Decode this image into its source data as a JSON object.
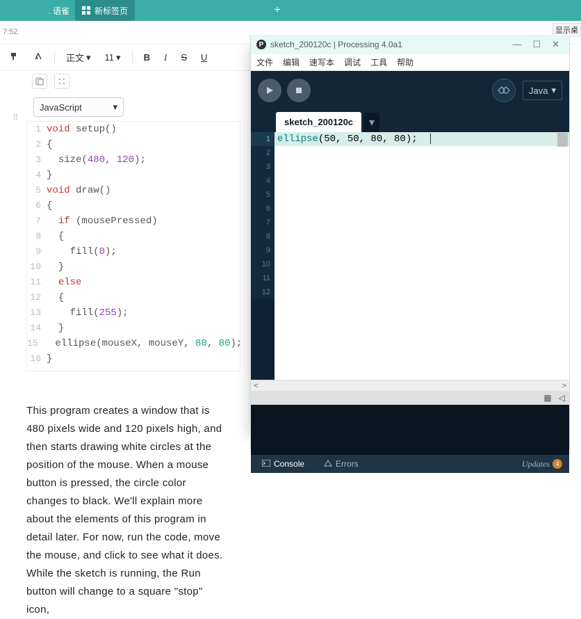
{
  "browser": {
    "tab_left_suffix": ". 语雀",
    "new_tab": "新标签页",
    "plus": "+",
    "time": "7:52",
    "top_right": "显示桌"
  },
  "toolbar": {
    "style_label": "正文",
    "font_size": "11",
    "bold": "B",
    "italic": "I",
    "strike": "S",
    "underline": "U"
  },
  "lang": {
    "value": "JavaScript"
  },
  "code": {
    "lines": [
      {
        "ln": "1",
        "tokens": [
          {
            "t": "void",
            "c": "k-red"
          },
          {
            "t": " setup()",
            "c": "k-text"
          }
        ]
      },
      {
        "ln": "2",
        "tokens": [
          {
            "t": "{",
            "c": "k-text"
          }
        ]
      },
      {
        "ln": "3",
        "tokens": [
          {
            "t": "  size(",
            "c": "k-text"
          },
          {
            "t": "480",
            "c": "k-violet"
          },
          {
            "t": ", ",
            "c": "k-text"
          },
          {
            "t": "120",
            "c": "k-violet"
          },
          {
            "t": ");",
            "c": "k-text"
          }
        ]
      },
      {
        "ln": "4",
        "tokens": [
          {
            "t": "}",
            "c": "k-text"
          }
        ]
      },
      {
        "ln": "5",
        "tokens": [
          {
            "t": "void",
            "c": "k-red"
          },
          {
            "t": " draw()",
            "c": "k-text"
          }
        ]
      },
      {
        "ln": "6",
        "tokens": [
          {
            "t": "{",
            "c": "k-text"
          }
        ]
      },
      {
        "ln": "7",
        "tokens": [
          {
            "t": "  ",
            "c": "k-text"
          },
          {
            "t": "if",
            "c": "k-red"
          },
          {
            "t": " (mousePressed)",
            "c": "k-text"
          }
        ]
      },
      {
        "ln": "8",
        "tokens": [
          {
            "t": "  {",
            "c": "k-text"
          }
        ]
      },
      {
        "ln": "9",
        "tokens": [
          {
            "t": "    fill(",
            "c": "k-text"
          },
          {
            "t": "0",
            "c": "k-violet"
          },
          {
            "t": ");",
            "c": "k-text"
          }
        ]
      },
      {
        "ln": "10",
        "tokens": [
          {
            "t": "  }",
            "c": "k-text"
          }
        ]
      },
      {
        "ln": "11",
        "tokens": [
          {
            "t": "  ",
            "c": "k-text"
          },
          {
            "t": "else",
            "c": "k-red"
          }
        ]
      },
      {
        "ln": "12",
        "tokens": [
          {
            "t": "  {",
            "c": "k-text"
          }
        ]
      },
      {
        "ln": "13",
        "tokens": [
          {
            "t": "    fill(",
            "c": "k-text"
          },
          {
            "t": "255",
            "c": "k-violet"
          },
          {
            "t": ");",
            "c": "k-text"
          }
        ]
      },
      {
        "ln": "14",
        "tokens": [
          {
            "t": "  }",
            "c": "k-text"
          }
        ]
      },
      {
        "ln": "15",
        "tokens": [
          {
            "t": "  ellipse(mouseX, mouseY, ",
            "c": "k-text"
          },
          {
            "t": "80",
            "c": "k-cyan"
          },
          {
            "t": ", ",
            "c": "k-text"
          },
          {
            "t": "80",
            "c": "k-cyan"
          },
          {
            "t": ");",
            "c": "k-text"
          }
        ]
      },
      {
        "ln": "16",
        "tokens": [
          {
            "t": "}",
            "c": "k-text"
          }
        ]
      }
    ]
  },
  "paragraph": "This program creates a window that is 480 pixels wide and 120 pixels high, and then starts drawing white circles at the position of the mouse. When a mouse button is pressed, the circle color changes to black. We'll explain more about the elements of this program in detail later. For now, run the code, move the mouse, and click to see what it does. While the sketch is running, the Run button will change to a square \"stop\" icon,",
  "processing": {
    "title": "sketch_200120c | Processing 4.0a1",
    "menu": [
      "文件",
      "编辑",
      "速写本",
      "调试",
      "工具",
      "帮助"
    ],
    "mode": "Java",
    "tab": "sketch_200120c",
    "gutter_count": 12,
    "code_line": {
      "fn": "ellipse",
      "args": "(50, 50, 80, 80);"
    },
    "scroll_left": "<",
    "scroll_right": ">",
    "console": "Console",
    "errors": "Errors",
    "updates": "Updates",
    "updates_count": "4",
    "win_min": "—",
    "win_max": "☐",
    "win_close": "✕"
  }
}
